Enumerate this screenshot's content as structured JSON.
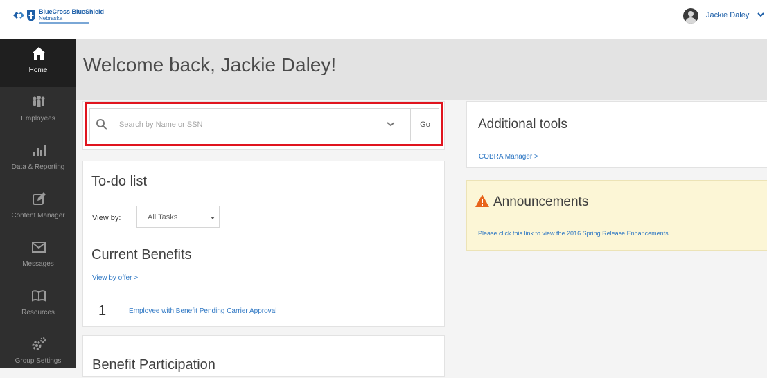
{
  "brand": {
    "name": "BlueCross BlueShield",
    "region": "Nebraska",
    "colors": {
      "primary": "#1d5fa8",
      "link": "#2c76c3",
      "highlight": "#e0141e",
      "announcement_bg": "#fcf6d6",
      "sidebar_bg": "#2f2f2f"
    }
  },
  "user": {
    "name": "Jackie Daley",
    "menu_icon": "chevron-down-icon"
  },
  "sidebar": {
    "items": [
      {
        "label": "Home",
        "icon": "home-icon",
        "active": true
      },
      {
        "label": "Employees",
        "icon": "people-icon"
      },
      {
        "label": "Data & Reporting",
        "icon": "bar-chart-icon"
      },
      {
        "label": "Content Manager",
        "icon": "pencil-icon"
      },
      {
        "label": "Messages",
        "icon": "envelope-icon"
      },
      {
        "label": "Resources",
        "icon": "book-icon"
      },
      {
        "label": "Group Settings",
        "icon": "gears-icon"
      }
    ]
  },
  "header": {
    "title": "Welcome back, Jackie Daley!"
  },
  "search": {
    "placeholder": "Search by Name or SSN",
    "go_label": "Go"
  },
  "todo": {
    "title": "To-do list",
    "view_by_label": "View by:",
    "view_by_value": "All Tasks",
    "current_benefits": {
      "title": "Current Benefits",
      "view_link": "View by offer >",
      "pending": {
        "count": "1",
        "label": "Employee with Benefit Pending Carrier Approval"
      }
    }
  },
  "benefit_participation": {
    "title": "Benefit Participation"
  },
  "tools": {
    "title": "Additional tools",
    "cobra_link": "COBRA Manager >"
  },
  "announcements": {
    "title": "Announcements",
    "link": "Please click this link to view the 2016 Spring Release Enhancements."
  }
}
